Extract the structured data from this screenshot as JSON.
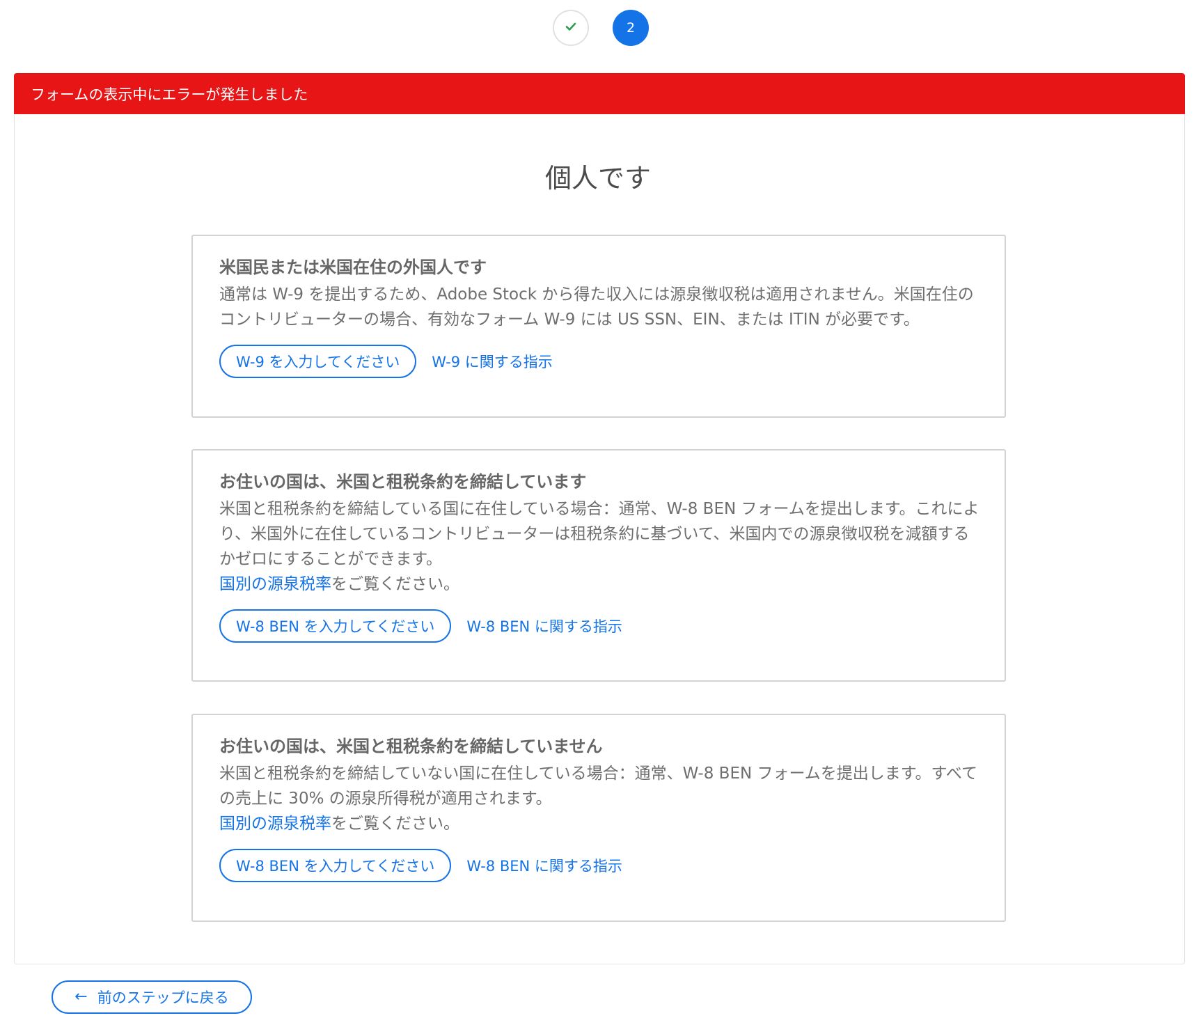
{
  "stepper": {
    "steps": [
      {
        "state": "done",
        "icon": "check-icon"
      },
      {
        "state": "current",
        "label": "2"
      }
    ]
  },
  "error_banner": {
    "text": "フォームの表示中にエラーが発生しました"
  },
  "page_title": "個人です",
  "cards": [
    {
      "title": "米国民または米国在住の外国人です",
      "description": "通常は W-9 を提出するため、Adobe Stock から得た収入には源泉徴収税は適用されません。米国在住のコントリビューターの場合、有効なフォーム W-9 には US SSN、EIN、または ITIN が必要です。",
      "button_label": "W-9 を入力してください",
      "instructions_link": "W-9 に関する指示"
    },
    {
      "title": "お住いの国は、米国と租税条約を締結しています",
      "description": "米国と租税条約を締結している国に在住している場合：通常、W-8 BEN フォームを提出します。これにより、米国外に在住しているコントリビューターは租税条約に基づいて、米国内での源泉徴収税を減額するかゼロにすることができます。",
      "rates_link": "国別の源泉税率",
      "rates_suffix": "をご覧ください。",
      "button_label": "W-8 BEN を入力してください",
      "instructions_link": "W-8 BEN に関する指示"
    },
    {
      "title": "お住いの国は、米国と租税条約を締結していません",
      "description": "米国と租税条約を締結していない国に在住している場合：通常、W-8 BEN フォームを提出します。すべての売上に 30% の源泉所得税が適用されます。",
      "rates_link": "国別の源泉税率",
      "rates_suffix": "をご覧ください。",
      "button_label": "W-8 BEN を入力してください",
      "instructions_link": "W-8 BEN に関する指示"
    }
  ],
  "back_button": {
    "icon": "arrow-left-icon",
    "label": "前のステップに戻る"
  },
  "colors": {
    "accent": "#1473e6",
    "error": "#e71515",
    "check": "#2d9d4f"
  }
}
